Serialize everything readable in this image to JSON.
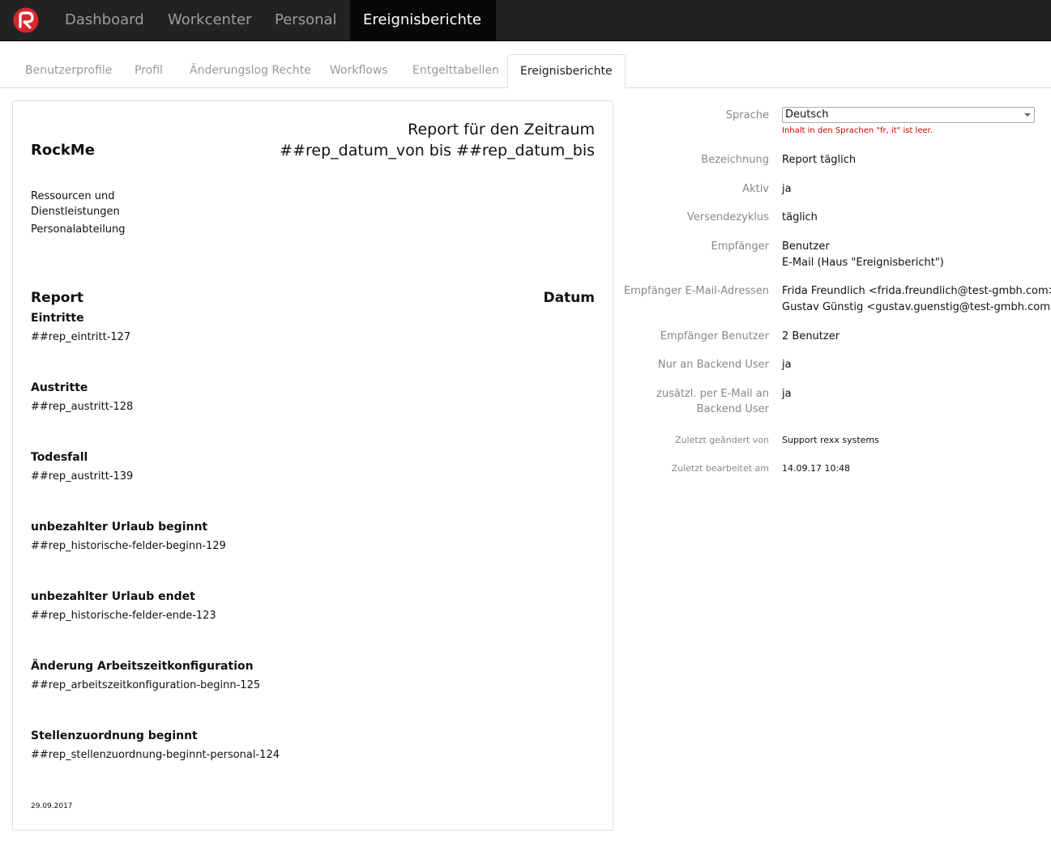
{
  "colors": {
    "navbar_bg": "#222222",
    "navbar_active_bg": "#080808",
    "logo_red": "#d9262e",
    "warning": "#cc0000"
  },
  "nav": {
    "items": [
      {
        "label": "Dashboard"
      },
      {
        "label": "Workcenter"
      },
      {
        "label": "Personal"
      },
      {
        "label": "Ereignisberichte"
      }
    ]
  },
  "tabs": [
    {
      "label": "Benutzerprofile"
    },
    {
      "label": "Profil"
    },
    {
      "label": "Änderungslog Rechte"
    },
    {
      "label": "Workflows"
    },
    {
      "label": "Entgelttabellen"
    },
    {
      "label": "Ereignisberichte"
    }
  ],
  "report": {
    "company": "RockMe",
    "title": "Report für den Zeitraum ##rep_datum_von bis ##rep_datum_bis",
    "dept1": "Ressourcen und Dienstleistungen",
    "dept2": "Personalabteilung",
    "head_report": "Report",
    "head_datum": "Datum",
    "sections": [
      {
        "title": "Eintritte",
        "value": "##rep_eintritt-127"
      },
      {
        "title": "Austritte",
        "value": "##rep_austritt-128"
      },
      {
        "title": "Todesfall",
        "value": "##rep_austritt-139"
      },
      {
        "title": "unbezahlter Urlaub beginnt",
        "value": "##rep_historische-felder-beginn-129"
      },
      {
        "title": "unbezahlter Urlaub endet",
        "value": "##rep_historische-felder-ende-123"
      },
      {
        "title": "Änderung Arbeitszeitkonfiguration",
        "value": "##rep_arbeitszeitkonfiguration-beginn-125"
      },
      {
        "title": "Stellenzuordnung beginnt",
        "value": "##rep_stellenzuordnung-beginnt-personal-124"
      }
    ],
    "date": "29.09.2017"
  },
  "details": {
    "sprache_label": "Sprache",
    "sprache_value": "Deutsch",
    "sprache_warning": "Inhalt in den Sprachen \"fr, it\" ist leer.",
    "bezeichnung_label": "Bezeichnung",
    "bezeichnung_value": "Report täglich",
    "aktiv_label": "Aktiv",
    "aktiv_value": "ja",
    "zyklus_label": "Versendezyklus",
    "zyklus_value": "täglich",
    "empfaenger_label": "Empfänger",
    "empfaenger_value1": "Benutzer",
    "empfaenger_value2": "E-Mail (Haus \"Ereignisbericht\")",
    "email_label": "Empfänger E-Mail-Adressen",
    "email_value1": "Frida Freundlich <frida.freundlich@test-gmbh.com>",
    "email_value2": "Gustav Günstig <gustav.guenstig@test-gmbh.com>",
    "benutzer_label": "Empfänger Benutzer",
    "benutzer_value": "2 Benutzer",
    "backend_label": "Nur an Backend User",
    "backend_value": "ja",
    "zusaetzl_label1": "zusätzl. per E-Mail an",
    "zusaetzl_label2": "Backend User",
    "zusaetzl_value": "ja",
    "geaendert_label": "Zuletzt geändert von",
    "geaendert_value": "Support rexx systems",
    "bearbeitet_label": "Zuletzt bearbeitet am",
    "bearbeitet_value": "14.09.17 10:48"
  }
}
